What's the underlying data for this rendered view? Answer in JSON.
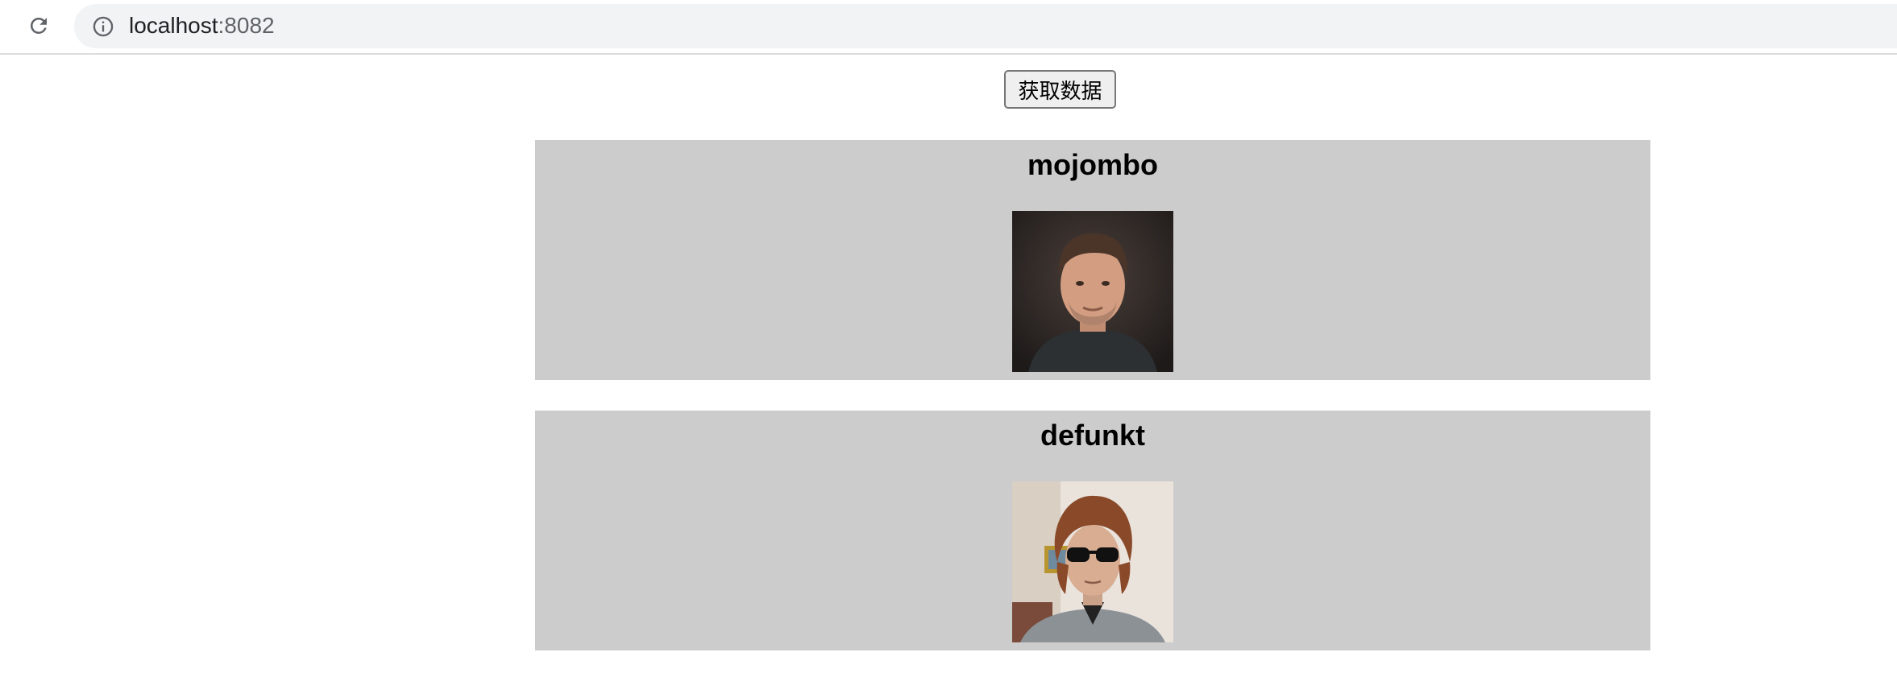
{
  "browser": {
    "url_host": "localhost",
    "url_port": ":8082"
  },
  "page": {
    "fetch_button_label": "获取数据"
  },
  "users": [
    {
      "login": "mojombo",
      "avatar_icon": "avatar-photo-icon"
    },
    {
      "login": "defunkt",
      "avatar_icon": "avatar-photo-icon"
    }
  ],
  "colors": {
    "card_background": "#cccccc",
    "omnibox_background": "#f1f3f4"
  }
}
